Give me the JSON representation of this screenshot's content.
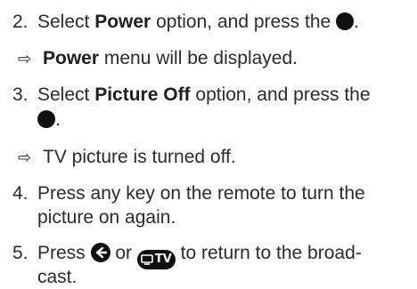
{
  "steps": [
    {
      "number": "2.",
      "pre": "Select ",
      "bold": "Power",
      "post": " option, and press the ",
      "result_bold": "Power",
      "result_text": " menu will be displayed."
    },
    {
      "number": "3.",
      "pre": "Select ",
      "bold": "Picture Off",
      "post": " option, and press the",
      "end": ".",
      "result_text": "TV picture is turned off."
    },
    {
      "number": "4.",
      "line1": "Press any key on the remote to turn the",
      "line2": "picture on again."
    },
    {
      "number": "5.",
      "pre": "Press ",
      "mid": " or ",
      "tv_label": "TV",
      "post": " to return to the broad-",
      "line2": "cast."
    }
  ],
  "icons": {
    "ok": "ok-button-icon",
    "result": "arrow-right-icon",
    "back": "back-button-icon",
    "tv": "tv-button-icon"
  },
  "result_arrow": "⇨"
}
